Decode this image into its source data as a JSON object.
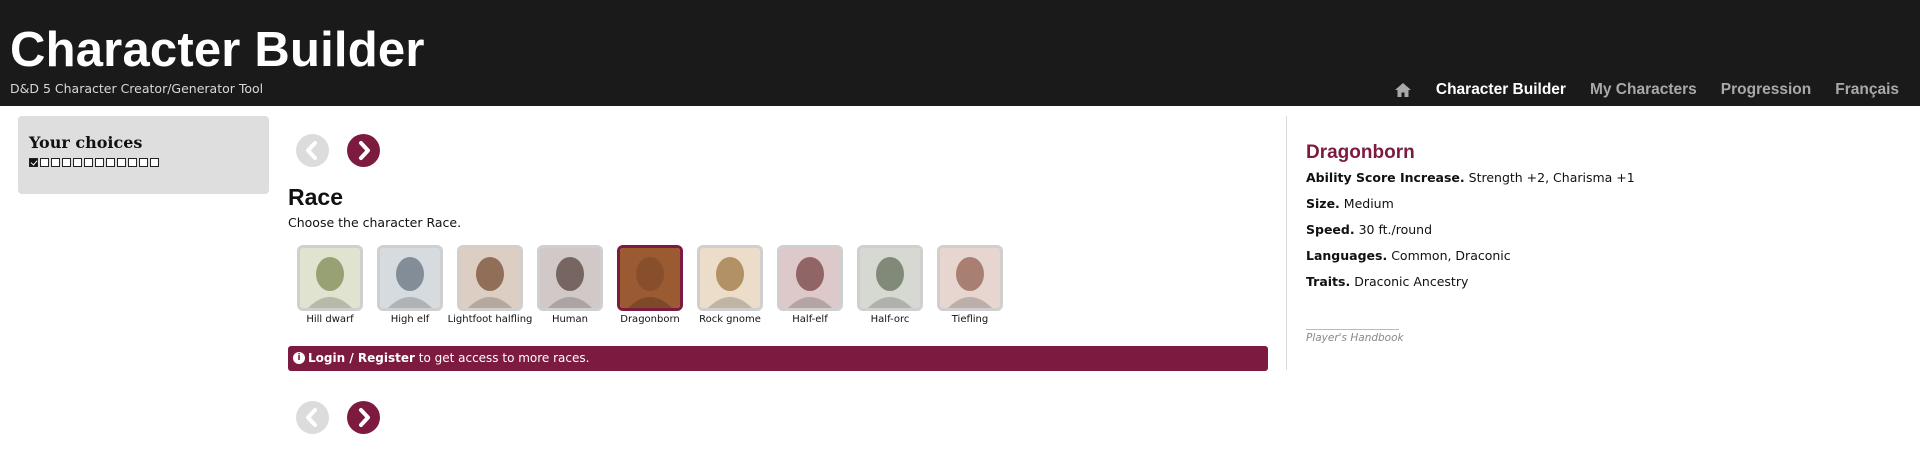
{
  "header": {
    "title": "Character Builder",
    "subtitle": "D&D 5 Character Creator/Generator Tool",
    "nav": {
      "home_icon": "home-icon",
      "items": [
        "Character Builder",
        "My Characters",
        "Progression",
        "Français"
      ],
      "active_index": 0
    }
  },
  "sidebar": {
    "title": "Your choices",
    "steps_total": 12,
    "steps_checked": 1
  },
  "main": {
    "prev_icon": "chevron-left-icon",
    "next_icon": "chevron-right-icon",
    "heading": "Race",
    "description": "Choose the character Race.",
    "races": [
      {
        "label": "Hill dwarf",
        "tint": "#a8b27a"
      },
      {
        "label": "High elf",
        "tint": "#8e9aa6"
      },
      {
        "label": "Lightfoot halfling",
        "tint": "#a0765a"
      },
      {
        "label": "Human",
        "tint": "#7e6a64"
      },
      {
        "label": "Dragonborn",
        "tint": "#9a5a32"
      },
      {
        "label": "Rock gnome",
        "tint": "#c6a06a"
      },
      {
        "label": "Half-elf",
        "tint": "#a06a6a"
      },
      {
        "label": "Half-orc",
        "tint": "#8c9682"
      },
      {
        "label": "Tiefling",
        "tint": "#bc8a78"
      }
    ],
    "selected_index": 4,
    "banner": {
      "icon": "info-icon",
      "login": "Login",
      "sep": " / ",
      "register": "Register",
      "rest": " to get access to more races."
    }
  },
  "detail": {
    "name": "Dragonborn",
    "lines": [
      {
        "label": "Ability Score Increase",
        "value": "Strength +2, Charisma +1"
      },
      {
        "label": "Size",
        "value": "Medium"
      },
      {
        "label": "Speed",
        "value": "30 ft./round"
      },
      {
        "label": "Languages",
        "value": "Common, Draconic"
      },
      {
        "label": "Traits",
        "value": "Draconic Ancestry"
      }
    ],
    "source": "Player's Handbook"
  },
  "colors": {
    "accent": "#7c1b3f",
    "topbar": "#1a1a1a",
    "panel": "#dedede"
  }
}
